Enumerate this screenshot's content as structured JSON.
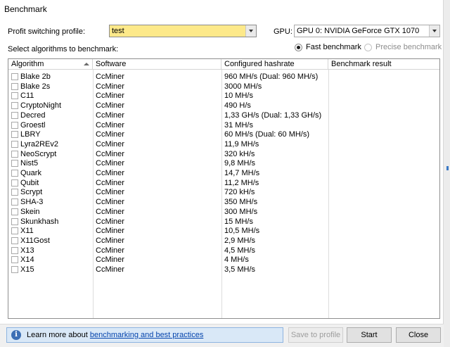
{
  "window": {
    "title": "Benchmark"
  },
  "profile": {
    "label": "Profit switching profile:",
    "value": "test"
  },
  "gpu": {
    "label": "GPU:",
    "value": "GPU 0: NVIDIA GeForce GTX 1070"
  },
  "select_label": "Select algorithms to benchmark:",
  "benchmark_mode": {
    "fast": {
      "label": "Fast benchmark",
      "selected": true
    },
    "precise": {
      "label": "Precise benchmark",
      "selected": false,
      "enabled": false
    }
  },
  "table": {
    "columns": [
      "Algorithm",
      "Software",
      "Configured hashrate",
      "Benchmark result"
    ],
    "sort": {
      "column": "Algorithm",
      "direction": "ascending"
    },
    "rows": [
      {
        "algorithm": "Blake 2b",
        "software": "CcMiner",
        "hashrate": "960 MH/s (Dual: 960 MH/s)",
        "result": "",
        "checked": false
      },
      {
        "algorithm": "Blake 2s",
        "software": "CcMiner",
        "hashrate": "3000 MH/s",
        "result": "",
        "checked": false
      },
      {
        "algorithm": "C11",
        "software": "CcMiner",
        "hashrate": "10 MH/s",
        "result": "",
        "checked": false
      },
      {
        "algorithm": "CryptoNight",
        "software": "CcMiner",
        "hashrate": "490 H/s",
        "result": "",
        "checked": false
      },
      {
        "algorithm": "Decred",
        "software": "CcMiner",
        "hashrate": "1,33 GH/s (Dual: 1,33 GH/s)",
        "result": "",
        "checked": false
      },
      {
        "algorithm": "Groestl",
        "software": "CcMiner",
        "hashrate": "31 MH/s",
        "result": "",
        "checked": false
      },
      {
        "algorithm": "LBRY",
        "software": "CcMiner",
        "hashrate": "60 MH/s (Dual: 60 MH/s)",
        "result": "",
        "checked": false
      },
      {
        "algorithm": "Lyra2REv2",
        "software": "CcMiner",
        "hashrate": "11,9 MH/s",
        "result": "",
        "checked": false
      },
      {
        "algorithm": "NeoScrypt",
        "software": "CcMiner",
        "hashrate": "320 kH/s",
        "result": "",
        "checked": false
      },
      {
        "algorithm": "Nist5",
        "software": "CcMiner",
        "hashrate": "9,8 MH/s",
        "result": "",
        "checked": false
      },
      {
        "algorithm": "Quark",
        "software": "CcMiner",
        "hashrate": "14,7 MH/s",
        "result": "",
        "checked": false
      },
      {
        "algorithm": "Qubit",
        "software": "CcMiner",
        "hashrate": "11,2 MH/s",
        "result": "",
        "checked": false
      },
      {
        "algorithm": "Scrypt",
        "software": "CcMiner",
        "hashrate": "720 kH/s",
        "result": "",
        "checked": false
      },
      {
        "algorithm": "SHA-3",
        "software": "CcMiner",
        "hashrate": "350 MH/s",
        "result": "",
        "checked": false
      },
      {
        "algorithm": "Skein",
        "software": "CcMiner",
        "hashrate": "300 MH/s",
        "result": "",
        "checked": false
      },
      {
        "algorithm": "Skunkhash",
        "software": "CcMiner",
        "hashrate": "15 MH/s",
        "result": "",
        "checked": false
      },
      {
        "algorithm": "X11",
        "software": "CcMiner",
        "hashrate": "10,5 MH/s",
        "result": "",
        "checked": false
      },
      {
        "algorithm": "X11Gost",
        "software": "CcMiner",
        "hashrate": "2,9 MH/s",
        "result": "",
        "checked": false
      },
      {
        "algorithm": "X13",
        "software": "CcMiner",
        "hashrate": "4,5 MH/s",
        "result": "",
        "checked": false
      },
      {
        "algorithm": "X14",
        "software": "CcMiner",
        "hashrate": "4 MH/s",
        "result": "",
        "checked": false
      },
      {
        "algorithm": "X15",
        "software": "CcMiner",
        "hashrate": "3,5 MH/s",
        "result": "",
        "checked": false
      }
    ]
  },
  "footer": {
    "info_icon": "info-icon",
    "info_prefix": "Learn more about ",
    "info_link": "benchmarking and best practices",
    "save_label": "Save to profile",
    "save_enabled": false,
    "start_label": "Start",
    "close_label": "Close"
  },
  "colors": {
    "profile_highlight": "#fde98a",
    "info_background": "#d9e8f7",
    "info_icon": "#3c6fb5",
    "link": "#0645ad"
  }
}
